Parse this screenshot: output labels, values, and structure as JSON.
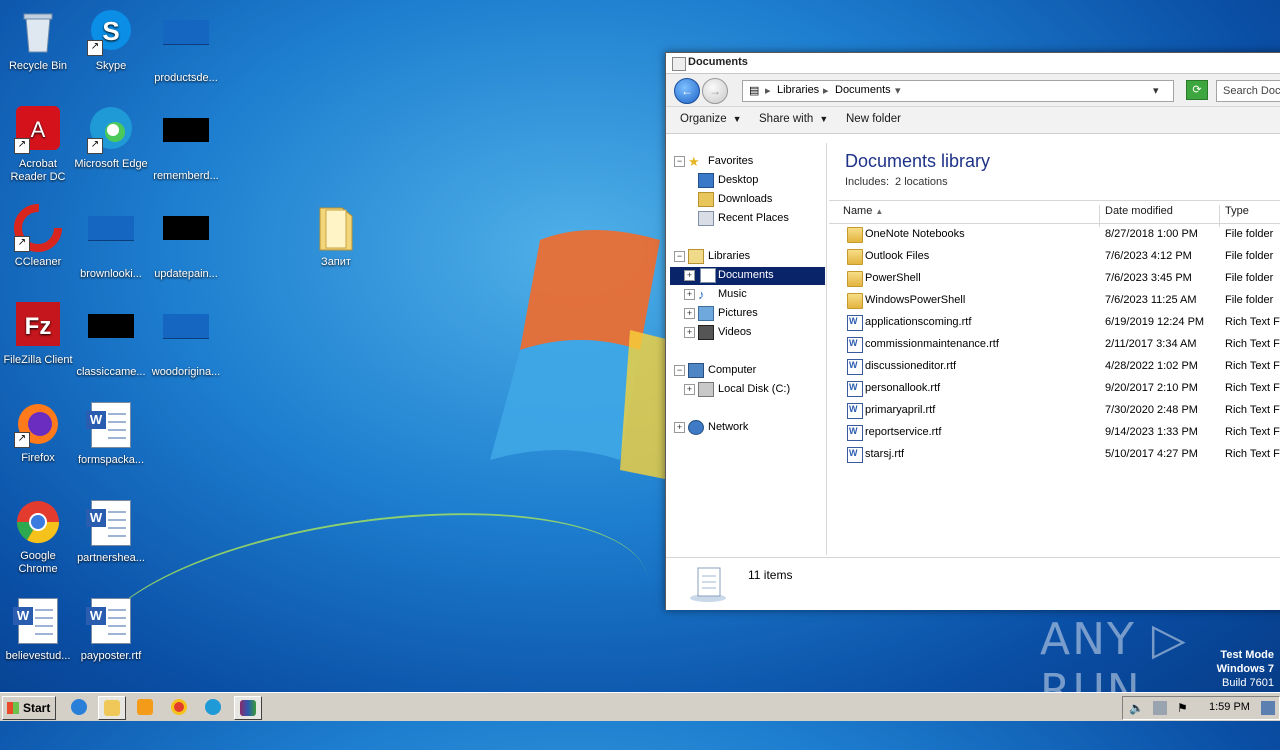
{
  "desktop": {
    "icons": [
      {
        "label": "Recycle Bin",
        "icon": "recycle-bin-icon"
      },
      {
        "label": "Skype",
        "icon": "skype-icon"
      },
      {
        "label": "productsde...",
        "icon": "file-icon"
      },
      {
        "label": "Acrobat Reader DC",
        "icon": "acrobat-icon"
      },
      {
        "label": "Microsoft Edge",
        "icon": "edge-icon"
      },
      {
        "label": "rememberd...",
        "icon": "file-icon"
      },
      {
        "label": "CCleaner",
        "icon": "ccleaner-icon"
      },
      {
        "label": "brownlooki...",
        "icon": "file-icon"
      },
      {
        "label": "updatepain...",
        "icon": "file-icon"
      },
      {
        "label": "Запит",
        "icon": "folder-icon"
      },
      {
        "label": "FileZilla Client",
        "icon": "filezilla-icon"
      },
      {
        "label": "classiccame...",
        "icon": "file-icon"
      },
      {
        "label": "woodorigina...",
        "icon": "file-icon"
      },
      {
        "label": "Firefox",
        "icon": "firefox-icon"
      },
      {
        "label": "formspacka...",
        "icon": "word-doc-icon"
      },
      {
        "label": "Google Chrome",
        "icon": "chrome-icon"
      },
      {
        "label": "partnershea...",
        "icon": "word-doc-icon"
      },
      {
        "label": "believestud...",
        "icon": "word-doc-icon"
      },
      {
        "label": "payposter.rtf",
        "icon": "word-doc-icon"
      }
    ]
  },
  "window": {
    "title": "Documents",
    "address": {
      "crumb1": "Libraries",
      "crumb2": "Documents"
    },
    "search_placeholder": "Search Docu",
    "toolbar": {
      "organize": "Organize",
      "share_with": "Share with",
      "new_folder": "New folder"
    },
    "nav": {
      "favorites": "Favorites",
      "desktop": "Desktop",
      "downloads": "Downloads",
      "recent_places": "Recent Places",
      "libraries": "Libraries",
      "documents": "Documents",
      "music": "Music",
      "pictures": "Pictures",
      "videos": "Videos",
      "computer": "Computer",
      "local_disk": "Local Disk (C:)",
      "network": "Network"
    },
    "library_title": "Documents library",
    "includes_label": "Includes:",
    "includes_value": "2 locations",
    "columns": {
      "name": "Name",
      "date": "Date modified",
      "type": "Type"
    },
    "files": [
      {
        "name": "OneNote Notebooks",
        "date": "8/27/2018 1:00 PM",
        "type": "File folder",
        "kind": "folder"
      },
      {
        "name": "Outlook Files",
        "date": "7/6/2023 4:12 PM",
        "type": "File folder",
        "kind": "folder"
      },
      {
        "name": "PowerShell",
        "date": "7/6/2023 3:45 PM",
        "type": "File folder",
        "kind": "folder"
      },
      {
        "name": "WindowsPowerShell",
        "date": "7/6/2023 11:25 AM",
        "type": "File folder",
        "kind": "folder"
      },
      {
        "name": "applicationscoming.rtf",
        "date": "6/19/2019 12:24 PM",
        "type": "Rich Text Fo",
        "kind": "rtf"
      },
      {
        "name": "commissionmaintenance.rtf",
        "date": "2/11/2017 3:34 AM",
        "type": "Rich Text Fo",
        "kind": "rtf"
      },
      {
        "name": "discussioneditor.rtf",
        "date": "4/28/2022 1:02 PM",
        "type": "Rich Text Fo",
        "kind": "rtf"
      },
      {
        "name": "personallook.rtf",
        "date": "9/20/2017 2:10 PM",
        "type": "Rich Text Fo",
        "kind": "rtf"
      },
      {
        "name": "primaryapril.rtf",
        "date": "7/30/2020 2:48 PM",
        "type": "Rich Text Fo",
        "kind": "rtf"
      },
      {
        "name": "reportservice.rtf",
        "date": "9/14/2023 1:33 PM",
        "type": "Rich Text Fo",
        "kind": "rtf"
      },
      {
        "name": "starsj.rtf",
        "date": "5/10/2017 4:27 PM",
        "type": "Rich Text Fo",
        "kind": "rtf"
      }
    ],
    "status": "11 items"
  },
  "watermark": "ANY ▷ RUN",
  "test_mode": {
    "line1": "Test Mode",
    "line2": "Windows 7",
    "line3": "Build 7601"
  },
  "taskbar": {
    "start": "Start",
    "clock": "1:59 PM"
  },
  "colors": {
    "selection": "#0a246a",
    "library_title": "#1e3287",
    "taskbar": "#d4d0c8"
  }
}
